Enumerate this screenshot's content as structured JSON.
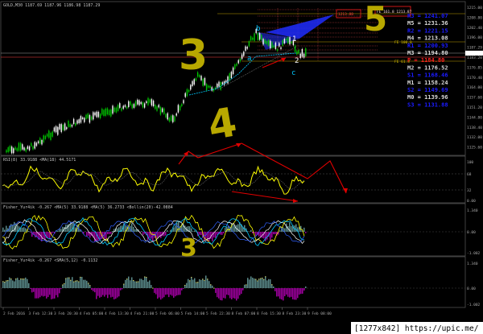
{
  "window": {
    "title": "GOLD,M30  1187.69 1187.96 1186.98 1187.29",
    "watermark": "[1277x842] https://upic.me/"
  },
  "panels": {
    "rsi": {
      "title": "RSI(8) 33.9188   <MA(18) 44.5171"
    },
    "fisher1": {
      "title": "Fisher_Yur4ik -0.267  <MA(5) 33.9188  <MA(5) 36.2733  <Bollin(20)-42.0884"
    },
    "fisher2": {
      "title": "Fisher_Yur4ik -0.267  <SMA(5,12) -0.1132"
    }
  },
  "annotations": {
    "wave_3_main": "3",
    "wave_4": "4",
    "wave_5": "5",
    "wave_3_lower": "3",
    "pattern_a": "a",
    "pattern_b": "b",
    "pattern_c": "c",
    "pattern_1": "1",
    "pattern_2": "2",
    "fe_100": "FE 100.0",
    "fe_618": "FE 61.8",
    "fe_box_label": "FE 161.8 1213.87",
    "small_box_label": "1213.88"
  },
  "levels": [
    {
      "label": "R3 = 1241.07",
      "color": "#1b1bff"
    },
    {
      "label": "M5 = 1231.36",
      "color": "#d8d8d8"
    },
    {
      "label": "R2 = 1221.15",
      "color": "#1b1bff"
    },
    {
      "label": "M4 = 1213.08",
      "color": "#d8d8d8"
    },
    {
      "label": "R1 = 1200.93",
      "color": "#1b1bff"
    },
    {
      "label": "M3 = 1194.80",
      "color": "#d8d8d8"
    },
    {
      "label": "P = 1184.80",
      "color": "#ff2020"
    },
    {
      "label": "M2 = 1176.52",
      "color": "#d8d8d8"
    },
    {
      "label": "S1 = 1168.46",
      "color": "#1b1bff"
    },
    {
      "label": "M1 = 1158.24",
      "color": "#d8d8d8"
    },
    {
      "label": "S2 = 1149.69",
      "color": "#1b1bff"
    },
    {
      "label": "M0 = 1139.96",
      "color": "#d8d8d8"
    },
    {
      "label": "S3 = 1131.88",
      "color": "#1b1bff"
    }
  ],
  "price_axis": [
    "1215.00",
    "1208.80",
    "1202.40",
    "1196.00",
    "1187.29",
    "1183.20",
    "1176.85",
    "1170.40",
    "1164.00",
    "1157.60",
    "1151.20",
    "1144.80",
    "1138.40",
    "1132.00",
    "1125.60"
  ],
  "rsi_axis": [
    "100",
    "68",
    "32",
    "0.00"
  ],
  "fisher1_axis": [
    "1.340",
    "0.00",
    "-1.002"
  ],
  "fisher2_axis": [
    "1.340",
    "0.00",
    "-1.002"
  ],
  "time_axis": [
    "2 Feb 2016",
    "3 Feb 12:30",
    "3 Feb 20:30",
    "4 Feb 05:00",
    "4 Feb 13:30",
    "4 Feb 21:00",
    "5 Feb 06:00",
    "5 Feb 14:00",
    "5 Feb 22:30",
    "8 Feb 07:00",
    "8 Feb 15:30",
    "8 Feb 23:30",
    "9 Feb 08:00"
  ],
  "colors": {
    "bull": "#00c800",
    "bear": "#ffffff",
    "cyan": "#00c8ff",
    "rsi": "#ffff00",
    "annot": "#b8a800",
    "arrow": "#e00000",
    "hist_pos": "#5a8a8a",
    "hist_neg": "#a000a0"
  }
}
